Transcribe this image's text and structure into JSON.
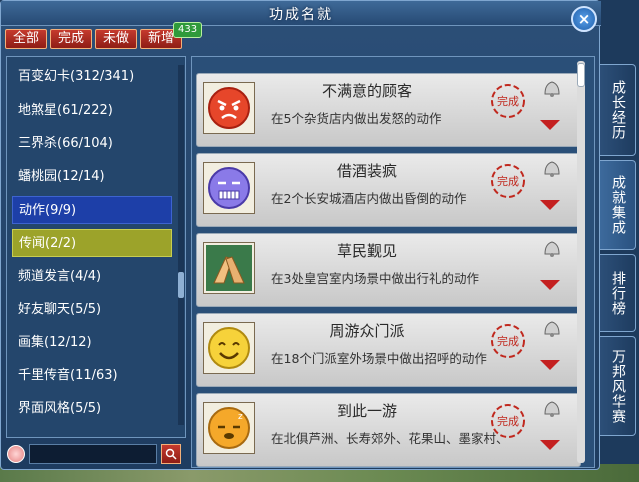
{
  "window": {
    "title": "功成名就",
    "close_label": "×"
  },
  "filters": [
    {
      "label": "全部"
    },
    {
      "label": "完成"
    },
    {
      "label": "未做"
    },
    {
      "label": "新增"
    }
  ],
  "badge": {
    "count": "433"
  },
  "categories": [
    {
      "label": "百变幻卡(312/341)"
    },
    {
      "label": "地煞星(61/222)"
    },
    {
      "label": "三界杀(66/104)"
    },
    {
      "label": "蟠桃园(12/14)"
    },
    {
      "label": "动作(9/9)"
    },
    {
      "label": "传闻(2/2)"
    },
    {
      "label": "频道发言(4/4)"
    },
    {
      "label": "好友聊天(5/5)"
    },
    {
      "label": "画集(12/12)"
    },
    {
      "label": "千里传音(11/63)"
    },
    {
      "label": "界面风格(5/5)"
    }
  ],
  "search": {
    "value": "",
    "button_label": "🔍"
  },
  "achievements": [
    {
      "name": "不满意的顾客",
      "desc": "在5个杂货店内做出发怒的动作",
      "icon": "angry-face-icon"
    },
    {
      "name": "借酒装疯",
      "desc": "在2个长安城酒店内做出昏倒的动作",
      "icon": "dizzy-face-icon"
    },
    {
      "name": "草民觐见",
      "desc": "在3处皇宫室内场景中做出行礼的动作",
      "icon": "salute-hands-icon"
    },
    {
      "name": "周游众门派",
      "desc": "在18个门派室外场景中做出招呼的动作",
      "icon": "smile-face-icon"
    },
    {
      "name": "到此一游",
      "desc": "在北俱芦洲、长寿郊外、花果山、墨家村、",
      "icon": "sleepy-face-icon"
    }
  ],
  "seal_text": "完成",
  "side_tabs": [
    {
      "label": "成长经历"
    },
    {
      "label": "成就集成"
    },
    {
      "label": "排行榜"
    },
    {
      "label": "万邦风华赛"
    }
  ],
  "colors": {
    "accent_red": "#c53a2e",
    "selected_blue": "#1d3fa8",
    "selected_olive": "#9ca32a",
    "panel": "#2a4f78"
  }
}
